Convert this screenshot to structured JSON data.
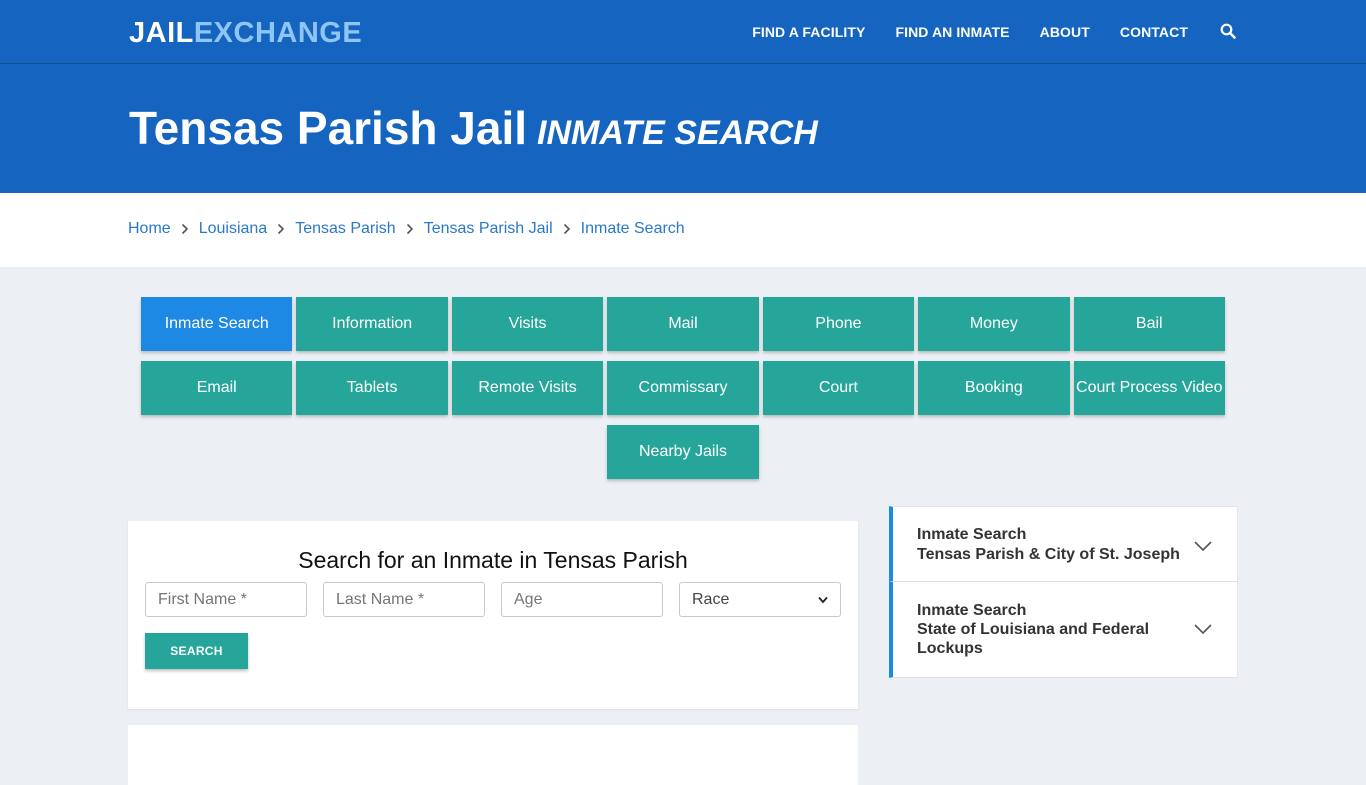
{
  "brand": {
    "part1": "JAIL",
    "part2": "EXCHANGE"
  },
  "nav": {
    "items": [
      "FIND A FACILITY",
      "FIND AN INMATE",
      "ABOUT",
      "CONTACT"
    ],
    "search_icon": "search-icon"
  },
  "hero": {
    "title": "Tensas Parish Jail",
    "subtitle": "INMATE SEARCH"
  },
  "breadcrumb": [
    "Home",
    "Louisiana",
    "Tensas Parish",
    "Tensas Parish Jail",
    "Inmate Search"
  ],
  "tabs": {
    "row1": [
      "Inmate Search",
      "Information",
      "Visits",
      "Mail",
      "Phone",
      "Money",
      "Bail"
    ],
    "row2": [
      "Email",
      "Tablets",
      "Remote Visits",
      "Commissary",
      "Court",
      "Booking",
      "Court Process Video"
    ],
    "row3": [
      "Nearby Jails"
    ],
    "active": "Inmate Search"
  },
  "search": {
    "heading": "Search for an Inmate in Tensas Parish",
    "first_name_placeholder": "First Name *",
    "last_name_placeholder": "Last Name *",
    "age_placeholder": "Age",
    "race_selected": "Race",
    "button": "SEARCH"
  },
  "sidebar": {
    "items": [
      {
        "line1": "Inmate Search",
        "line2": "Tensas Parish & City of St. Joseph"
      },
      {
        "line1": "Inmate Search",
        "line2": "State of Louisiana and Federal",
        "line3": "Lockups"
      }
    ]
  },
  "colors": {
    "primary": "#1565c0",
    "teal": "#26a69a",
    "active_tab": "#1e88e5",
    "link": "#2a78c8"
  }
}
